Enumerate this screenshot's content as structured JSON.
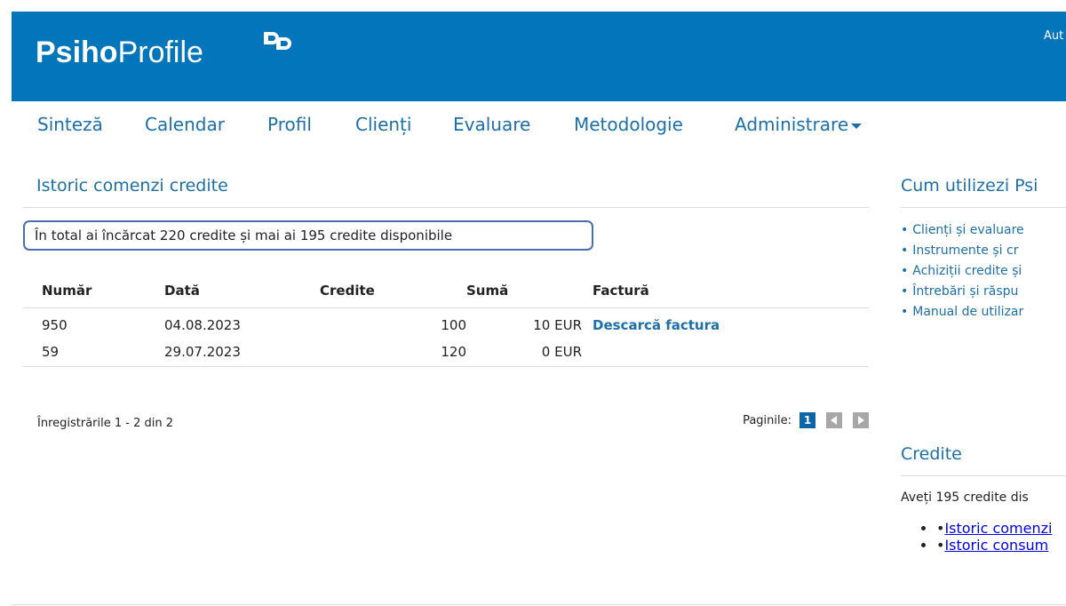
{
  "header": {
    "logo_bold": "Psiho",
    "logo_light": "Profile",
    "logo_mark_icon": "psihoprofile-logo-mark",
    "auth_link": "Aut",
    "bg_color": "#0275bb"
  },
  "nav": {
    "items": [
      "Sinteză",
      "Calendar",
      "Profil",
      "Clienți",
      "Evaluare",
      "Metodologie",
      "Administrare"
    ],
    "dropdown_icon": "caret-down-icon"
  },
  "main": {
    "title": "Istoric comenzi credite",
    "summary": "În total ai încărcat 220 credite și mai ai 195 credite disponibile",
    "table": {
      "headers": [
        "Număr",
        "Dată",
        "Credite",
        "Sumă",
        "Factură"
      ],
      "rows": [
        {
          "number": "950",
          "date": "04.08.2023",
          "credits": "100",
          "amount": "10 EUR",
          "invoice": "Descarcă factura"
        },
        {
          "number": "59",
          "date": "29.07.2023",
          "credits": "120",
          "amount": "0 EUR",
          "invoice": ""
        }
      ]
    },
    "records": "Înregistrările 1 - 2 din 2",
    "pager": {
      "label": "Paginile:",
      "current": "1",
      "prev_icon": "prev-arrow-icon",
      "next_icon": "next-arrow-icon"
    }
  },
  "sidebar": {
    "help_title": "Cum utilizezi Psi",
    "help_links": [
      "Clienți și evaluare",
      "Instrumente și cr",
      "Achiziții credite și",
      "Întrebări și răspu",
      "Manual de utilizar"
    ],
    "credits_title": "Credite",
    "credits_text": "Aveți 195 credite dis",
    "credits_links": [
      "Istoric comenzi",
      "Istoric consum"
    ]
  }
}
